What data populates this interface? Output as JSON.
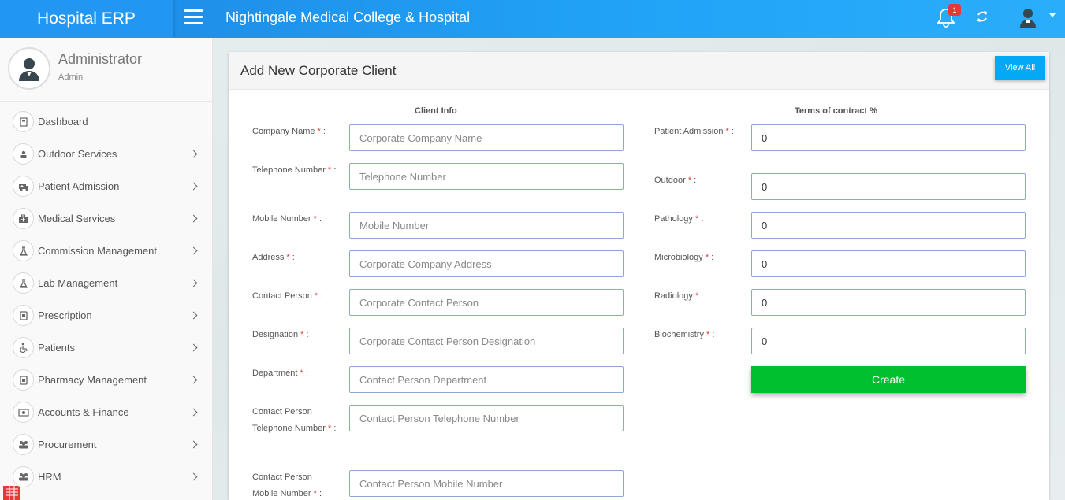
{
  "brand": "Hospital ERP",
  "hospital_name": "Nightingale Medical College & Hospital",
  "notifications_count": "1",
  "profile": {
    "name": "Administrator",
    "role": "Admin"
  },
  "menu": [
    {
      "label": "Dashboard",
      "icon": "dashboard-icon",
      "arrow": false
    },
    {
      "label": "Outdoor Services",
      "icon": "outdoor-icon",
      "arrow": true
    },
    {
      "label": "Patient Admission",
      "icon": "ambulance-icon",
      "arrow": true
    },
    {
      "label": "Medical Services",
      "icon": "medkit-icon",
      "arrow": true
    },
    {
      "label": "Commission Management",
      "icon": "flask-icon",
      "arrow": true
    },
    {
      "label": "Lab Management",
      "icon": "flask-icon",
      "arrow": true
    },
    {
      "label": "Prescription",
      "icon": "prescription-icon",
      "arrow": true
    },
    {
      "label": "Patients",
      "icon": "wheelchair-icon",
      "arrow": true
    },
    {
      "label": "Pharmacy Management",
      "icon": "pharmacy-icon",
      "arrow": true
    },
    {
      "label": "Accounts & Finance",
      "icon": "money-icon",
      "arrow": true
    },
    {
      "label": "Procurement",
      "icon": "users-icon",
      "arrow": true
    },
    {
      "label": "HRM",
      "icon": "users-icon",
      "arrow": true
    }
  ],
  "panel": {
    "title": "Add New Corporate Client",
    "view_all": "View All"
  },
  "client_info": {
    "heading": "Client Info",
    "fields": [
      {
        "label": "Company Name",
        "placeholder": "Corporate Company Name"
      },
      {
        "label": "Telephone Number",
        "placeholder": "Telephone Number"
      },
      {
        "label": "Mobile Number",
        "placeholder": "Mobile Number"
      },
      {
        "label": "Address",
        "placeholder": "Corporate Company Address"
      },
      {
        "label": "Contact Person",
        "placeholder": "Corporate Contact Person"
      },
      {
        "label": "Designation",
        "placeholder": "Corporate Contact Person Designation"
      },
      {
        "label": "Department",
        "placeholder": "Contact Person Department"
      },
      {
        "label": "Contact Person Telephone Number",
        "placeholder": "Contact Person Telephone Number"
      },
      {
        "label": "Contact Person Mobile Number",
        "placeholder": "Contact Person Mobile Number"
      }
    ]
  },
  "terms": {
    "heading": "Terms of contract %",
    "fields": [
      {
        "label": "Patient Admission",
        "value": "0"
      },
      {
        "label": "Outdoor",
        "value": "0"
      },
      {
        "label": "Pathology",
        "value": "0"
      },
      {
        "label": "Microbiology",
        "value": "0"
      },
      {
        "label": "Radiology",
        "value": "0"
      },
      {
        "label": "Biochemistry",
        "value": "0"
      }
    ],
    "create_label": "Create"
  },
  "required_marker": "*",
  "label_suffix": ":"
}
